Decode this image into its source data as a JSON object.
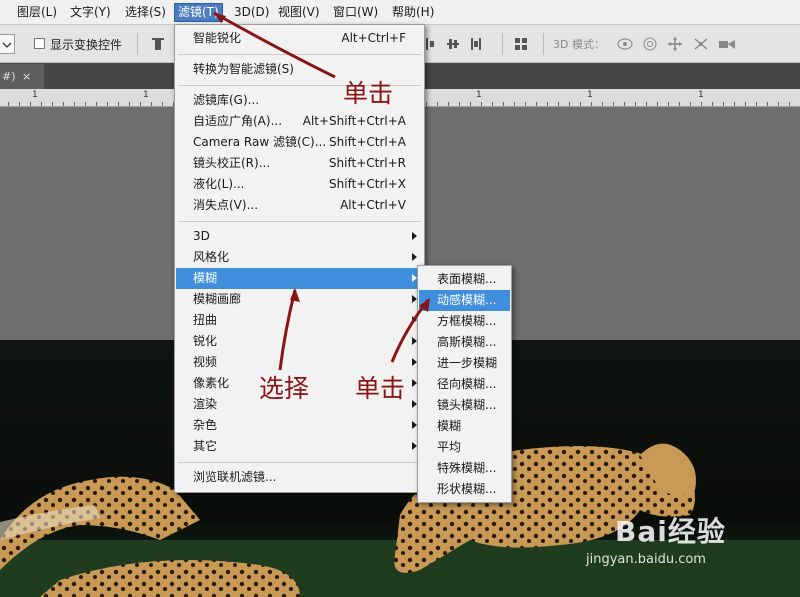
{
  "menubar": {
    "items": [
      {
        "label": "图层(L)"
      },
      {
        "label": "文字(Y)"
      },
      {
        "label": "选择(S)"
      },
      {
        "label": "滤镜(T)"
      },
      {
        "label": "3D(D)"
      },
      {
        "label": "视图(V)"
      },
      {
        "label": "窗口(W)"
      },
      {
        "label": "帮助(H)"
      }
    ]
  },
  "options_bar": {
    "show_transform_controls": "显示变换控件",
    "mode_3d_label": "3D 模式："
  },
  "document_tab": {
    "title": "#)",
    "close": "×"
  },
  "ruler": {
    "labels": [
      "1",
      "1",
      "1",
      "1",
      "1",
      "1",
      "1"
    ]
  },
  "filter_menu": {
    "groups": [
      [
        {
          "label": "智能锐化",
          "shortcut": "Alt+Ctrl+F"
        }
      ],
      [
        {
          "label": "转换为智能滤镜(S)",
          "shortcut": ""
        }
      ],
      [
        {
          "label": "滤镜库(G)...",
          "shortcut": ""
        },
        {
          "label": "自适应广角(A)...",
          "shortcut": "Alt+Shift+Ctrl+A"
        },
        {
          "label": "Camera Raw 滤镜(C)...",
          "shortcut": "Shift+Ctrl+A"
        },
        {
          "label": "镜头校正(R)...",
          "shortcut": "Shift+Ctrl+R"
        },
        {
          "label": "液化(L)...",
          "shortcut": "Shift+Ctrl+X"
        },
        {
          "label": "消失点(V)...",
          "shortcut": "Alt+Ctrl+V"
        }
      ],
      [
        {
          "label": "3D",
          "submenu": true
        },
        {
          "label": "风格化",
          "submenu": true
        },
        {
          "label": "模糊",
          "submenu": true,
          "highlighted": true
        },
        {
          "label": "模糊画廊",
          "submenu": true
        },
        {
          "label": "扭曲",
          "submenu": true
        },
        {
          "label": "锐化",
          "submenu": true
        },
        {
          "label": "视频",
          "submenu": true
        },
        {
          "label": "像素化",
          "submenu": true
        },
        {
          "label": "渲染",
          "submenu": true
        },
        {
          "label": "杂色",
          "submenu": true
        },
        {
          "label": "其它",
          "submenu": true
        }
      ],
      [
        {
          "label": "浏览联机滤镜...",
          "shortcut": ""
        }
      ]
    ]
  },
  "blur_submenu": {
    "items": [
      {
        "label": "表面模糊..."
      },
      {
        "label": "动感模糊...",
        "highlighted": true
      },
      {
        "label": "方框模糊..."
      },
      {
        "label": "高斯模糊..."
      },
      {
        "label": "进一步模糊"
      },
      {
        "label": "径向模糊..."
      },
      {
        "label": "镜头模糊..."
      },
      {
        "label": "模糊"
      },
      {
        "label": "平均"
      },
      {
        "label": "特殊模糊..."
      },
      {
        "label": "形状模糊..."
      }
    ]
  },
  "annotations": {
    "click_top": "单击",
    "select": "选择",
    "click_sub": "单击"
  },
  "watermark": {
    "brand": "Bai经验",
    "url": "jingyan.baidu.com"
  },
  "colors": {
    "menu_highlight": "#3f8fdc",
    "annotation": "#8a1414",
    "active_menubar": "#4b7cc0"
  }
}
